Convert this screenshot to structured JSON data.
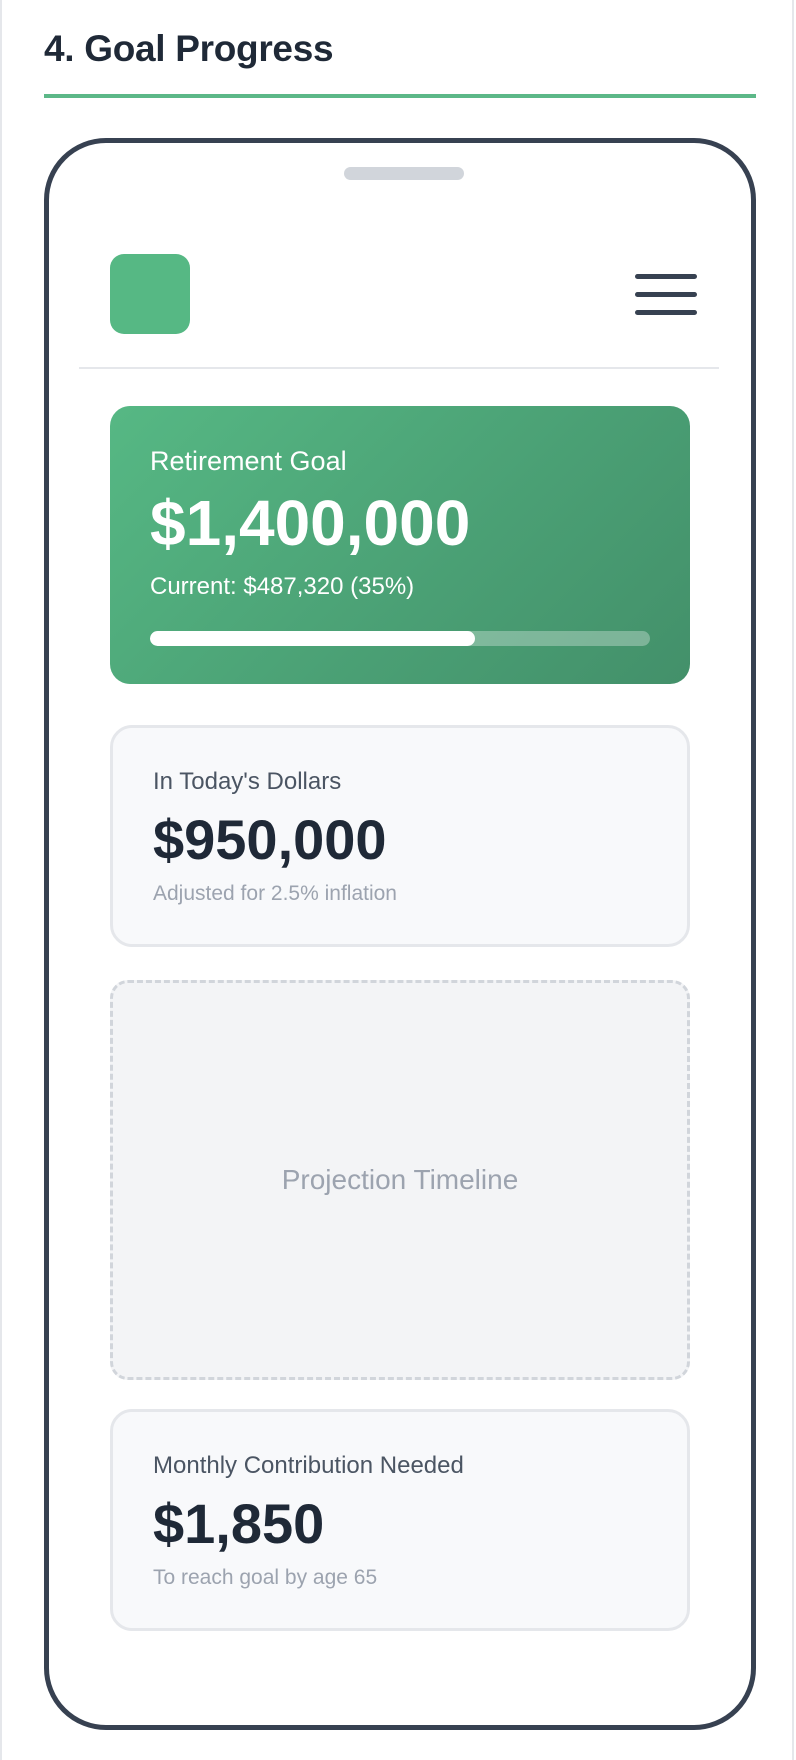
{
  "section": {
    "title": "4. Goal Progress"
  },
  "app": {
    "logo": "app-logo-square",
    "menu_icon": "hamburger-menu-icon"
  },
  "goal_card": {
    "label": "Retirement Goal",
    "amount": "$1,400,000",
    "current_text": "Current: $487,320 (35%)",
    "progress_fraction": 0.65
  },
  "today_card": {
    "label": "In Today's Dollars",
    "amount": "$950,000",
    "note": "Adjusted for 2.5% inflation"
  },
  "timeline": {
    "placeholder": "Projection Timeline"
  },
  "contribution_card": {
    "label": "Monthly Contribution Needed",
    "amount": "$1,850",
    "note": "To reach goal by age 65"
  },
  "colors": {
    "accent": "#56b884",
    "text_dark": "#1f2937",
    "phone_frame": "#374151"
  }
}
